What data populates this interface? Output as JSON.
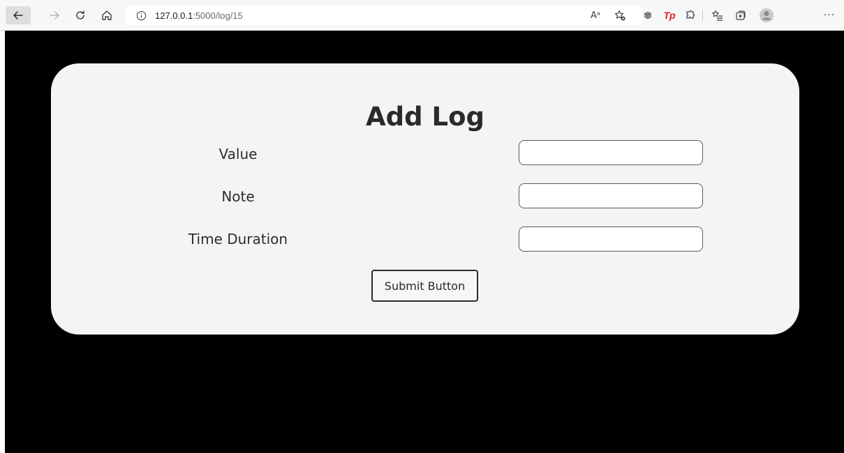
{
  "browser": {
    "url_host": "127.0.0.1",
    "url_path": ":5000/log/15",
    "extension_label": "Tp",
    "more_label": "···",
    "read_aloud_label": "Aᵃ"
  },
  "form": {
    "title": "Add Log",
    "fields": [
      {
        "label": "Value",
        "value": "",
        "placeholder": ""
      },
      {
        "label": "Note",
        "value": "",
        "placeholder": ""
      },
      {
        "label": "Time Duration",
        "value": "",
        "placeholder": ""
      }
    ],
    "submit_label": "Submit Button"
  },
  "colors": {
    "page_background": "#000000",
    "card_background": "#f4f4f4",
    "toolbar_background": "#f7f7f7",
    "extension_accent": "#e02020"
  },
  "icons": {
    "back": "arrow-left-icon",
    "forward": "arrow-right-icon",
    "refresh": "refresh-icon",
    "home": "home-icon",
    "info": "info-icon",
    "read_aloud": "read-aloud-icon",
    "favorite": "star-add-icon",
    "favorites": "favorites-list-icon",
    "collections": "collections-icon",
    "profile": "profile-icon",
    "more": "more-icon"
  }
}
